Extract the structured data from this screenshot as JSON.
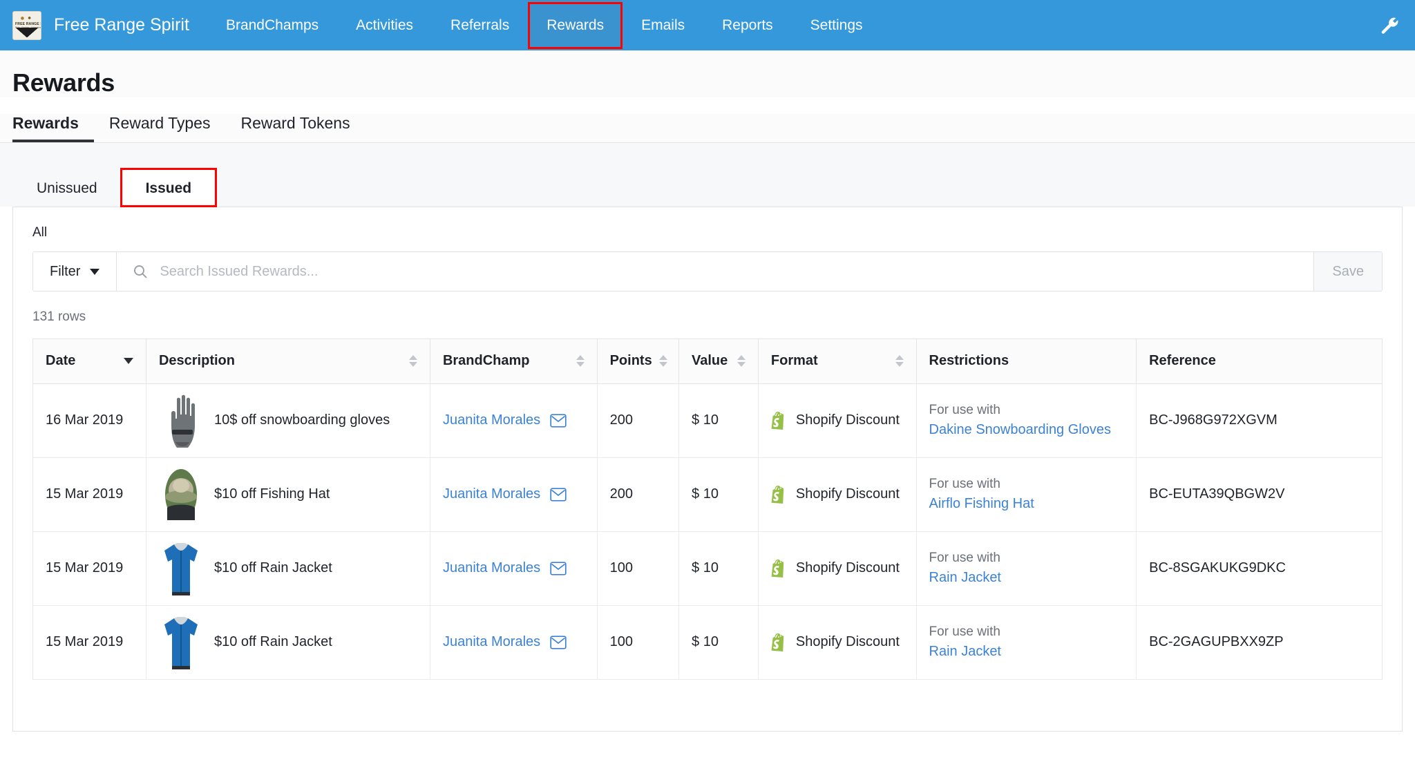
{
  "navbar": {
    "brand": "Free Range Spirit",
    "logo_text": "FREE RANGE SPIRIT",
    "logo_subtext": "Ride - Explore - Adventure",
    "items": [
      {
        "label": "BrandChamps",
        "active": false
      },
      {
        "label": "Activities",
        "active": false
      },
      {
        "label": "Referrals",
        "active": false
      },
      {
        "label": "Rewards",
        "active": true
      },
      {
        "label": "Emails",
        "active": false
      },
      {
        "label": "Reports",
        "active": false
      },
      {
        "label": "Settings",
        "active": false
      }
    ],
    "tools_icon": "wrench-icon"
  },
  "page": {
    "title": "Rewards"
  },
  "primary_tabs": [
    {
      "label": "Rewards",
      "active": true
    },
    {
      "label": "Reward Types",
      "active": false
    },
    {
      "label": "Reward Tokens",
      "active": false
    }
  ],
  "secondary_tabs": [
    {
      "label": "Unissued",
      "active": false
    },
    {
      "label": "Issued",
      "active": true
    }
  ],
  "panel": {
    "scope_label": "All",
    "filter_label": "Filter",
    "search_placeholder": "Search Issued Rewards...",
    "search_value": "",
    "save_label": "Save",
    "row_count": "131 rows"
  },
  "table": {
    "columns": [
      {
        "label": "Date",
        "sort": "desc"
      },
      {
        "label": "Description",
        "sort": "both"
      },
      {
        "label": "BrandChamp",
        "sort": "both"
      },
      {
        "label": "Points",
        "sort": "both"
      },
      {
        "label": "Value",
        "sort": "both"
      },
      {
        "label": "Format",
        "sort": "both"
      },
      {
        "label": "Restrictions",
        "sort": "none"
      },
      {
        "label": "Reference",
        "sort": "none"
      }
    ],
    "restriction_prefix": "For use with",
    "rows": [
      {
        "date": "16 Mar 2019",
        "thumb": "snowboarding-glove",
        "description": "10$ off snowboarding gloves",
        "brandchamp": "Juanita Morales",
        "points": "200",
        "value": "$ 10",
        "format": "Shopify Discount",
        "restriction_label": "For use with",
        "restriction_product": "Dakine Snowboarding Gloves",
        "reference": "BC-J968G972XGVM"
      },
      {
        "date": "15 Mar 2019",
        "thumb": "fishing-hat",
        "description": "$10 off Fishing Hat",
        "brandchamp": "Juanita Morales",
        "points": "200",
        "value": "$ 10",
        "format": "Shopify Discount",
        "restriction_label": "For use with",
        "restriction_product": "Airflo Fishing Hat",
        "reference": "BC-EUTA39QBGW2V"
      },
      {
        "date": "15 Mar 2019",
        "thumb": "rain-jacket",
        "description": "$10 off Rain Jacket",
        "brandchamp": "Juanita Morales",
        "points": "100",
        "value": "$ 10",
        "format": "Shopify Discount",
        "restriction_label": "For use with",
        "restriction_product": "Rain Jacket",
        "reference": "BC-8SGAKUKG9DKC"
      },
      {
        "date": "15 Mar 2019",
        "thumb": "rain-jacket",
        "description": "$10 off Rain Jacket",
        "brandchamp": "Juanita Morales",
        "points": "100",
        "value": "$ 10",
        "format": "Shopify Discount",
        "restriction_label": "For use with",
        "restriction_product": "Rain Jacket",
        "reference": "BC-2GAGUPBXX9ZP"
      }
    ]
  },
  "colors": {
    "navbar": "#3498db",
    "navbar_active": "#3a92cf",
    "highlight": "#ff0000",
    "link": "#3b82d6",
    "shopify_green": "#95bf47"
  }
}
